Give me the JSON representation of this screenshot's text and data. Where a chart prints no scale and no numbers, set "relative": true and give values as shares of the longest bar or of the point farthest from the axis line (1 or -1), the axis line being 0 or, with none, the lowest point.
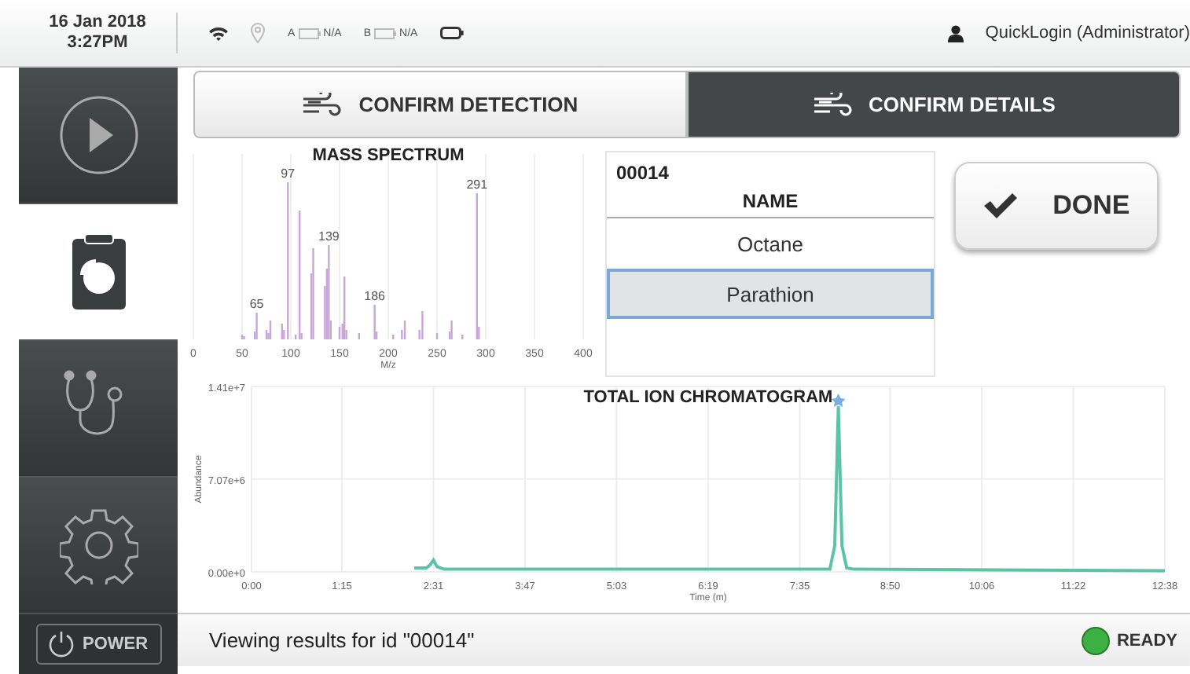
{
  "top_bar": {
    "date": "16 Jan 2018",
    "time": "3:27PM",
    "battery_a": {
      "letter": "A",
      "reading": "N/A"
    },
    "battery_b": {
      "letter": "B",
      "reading": "N/A"
    },
    "user": "QuickLogin (Administrator)"
  },
  "sidebar": {
    "items": [
      {
        "kind": "play",
        "selected": false
      },
      {
        "kind": "report",
        "selected": true
      },
      {
        "kind": "diagnostics",
        "selected": false
      },
      {
        "kind": "settings",
        "selected": false
      }
    ],
    "power_label": "POWER"
  },
  "tabs": [
    {
      "label": "CONFIRM DETECTION",
      "selected": false
    },
    {
      "label": "CONFIRM DETAILS",
      "selected": true
    }
  ],
  "mass_spectrum": {
    "chart_data": {
      "type": "bar",
      "title": "MASS SPECTRUM",
      "xlabel": "M/z",
      "xlim": [
        0,
        400
      ],
      "xticks": [
        0,
        50,
        100,
        150,
        200,
        250,
        300,
        350,
        400
      ],
      "x": [
        50,
        52,
        63,
        65,
        75,
        77,
        79,
        91,
        93,
        97,
        105,
        109,
        111,
        121,
        123,
        135,
        137,
        139,
        141,
        150,
        153,
        155,
        157,
        170,
        186,
        188,
        205,
        214,
        217,
        232,
        235,
        250,
        263,
        265,
        276,
        291,
        293
      ],
      "values": [
        0.03,
        0.02,
        0.05,
        0.17,
        0.06,
        0.04,
        0.12,
        0.1,
        0.06,
        1,
        0.03,
        0.82,
        0.04,
        0.42,
        0.58,
        0.34,
        0.45,
        0.6,
        0.12,
        0.08,
        0.1,
        0.4,
        0.06,
        0.04,
        0.22,
        0.05,
        0.03,
        0.06,
        0.12,
        0.06,
        0.18,
        0.04,
        0.05,
        0.12,
        0.03,
        0.93,
        0.08
      ],
      "relative": true,
      "grid": true,
      "annotations": [
        {
          "x": 65,
          "y": 0.17,
          "text": "65"
        },
        {
          "x": 97,
          "y": 1,
          "text": "97"
        },
        {
          "x": 139,
          "y": 0.6,
          "text": "139"
        },
        {
          "x": 186,
          "y": 0.22,
          "text": "186"
        },
        {
          "x": 291,
          "y": 0.93,
          "text": "291"
        }
      ]
    }
  },
  "results": {
    "id": "00014",
    "column": "NAME",
    "rows": [
      {
        "name": "Octane",
        "selected": false
      },
      {
        "name": "Parathion",
        "selected": true
      }
    ]
  },
  "done_button": "DONE",
  "chromatogram": {
    "chart_data": {
      "type": "line",
      "title": "TOTAL ION CHROMATOGRAM",
      "xlabel": "Time (m)",
      "ylabel": "Abundance",
      "xlim": [
        0,
        758
      ],
      "ylim": [
        0,
        14100000
      ],
      "xticks": [
        {
          "value": 0,
          "label": "0:00"
        },
        {
          "value": 75,
          "label": "1:15"
        },
        {
          "value": 151,
          "label": "2:31"
        },
        {
          "value": 227,
          "label": "3:47"
        },
        {
          "value": 303,
          "label": "5:03"
        },
        {
          "value": 379,
          "label": "6:19"
        },
        {
          "value": 455,
          "label": "7:35"
        },
        {
          "value": 530,
          "label": "8:50"
        },
        {
          "value": 606,
          "label": "10:06"
        },
        {
          "value": 682,
          "label": "11:22"
        },
        {
          "value": 758,
          "label": "12:38"
        }
      ],
      "yticks": [
        {
          "value": 0,
          "label": "0.00e+0"
        },
        {
          "value": 7070000,
          "label": "7.07e+6"
        },
        {
          "value": 14100000,
          "label": "1.41e+7"
        }
      ],
      "x": [
        135,
        145,
        148,
        151,
        154,
        160,
        300,
        480,
        484,
        487,
        490,
        494,
        500,
        758
      ],
      "grid": true,
      "series": [
        {
          "color": "#5cc4a6",
          "values": [
            300000,
            300000,
            500000,
            900000,
            400000,
            200000,
            200000,
            200000,
            2000000,
            12600000,
            2000000,
            300000,
            200000,
            100000
          ]
        }
      ]
    }
  },
  "status_bar": {
    "message": "Viewing results for id \"00014\"",
    "status": {
      "label": "READY",
      "color": "#3cb043"
    }
  }
}
